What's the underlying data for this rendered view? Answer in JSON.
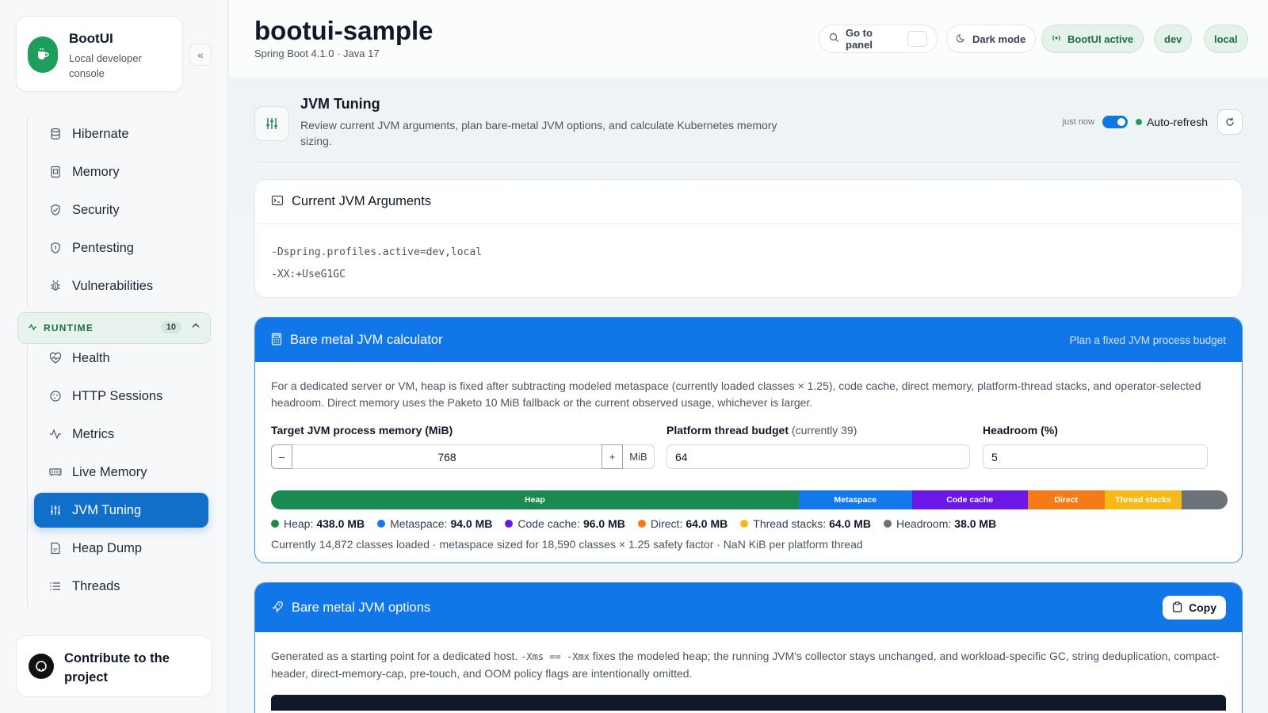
{
  "brand": {
    "title": "BootUI",
    "subtitle": "Local developer console",
    "collapse_icon": "«"
  },
  "sidebar": {
    "items_top": [
      {
        "label": "Hibernate",
        "icon": "database-icon"
      },
      {
        "label": "Memory",
        "icon": "memory-icon"
      },
      {
        "label": "Security",
        "icon": "shield-icon"
      },
      {
        "label": "Pentesting",
        "icon": "shield-alert-icon"
      },
      {
        "label": "Vulnerabilities",
        "icon": "bug-icon"
      }
    ],
    "runtime": {
      "label": "RUNTIME",
      "count": "10"
    },
    "items_runtime": [
      {
        "label": "Health",
        "icon": "heart-pulse-icon"
      },
      {
        "label": "HTTP Sessions",
        "icon": "cookie-icon"
      },
      {
        "label": "Metrics",
        "icon": "activity-icon"
      },
      {
        "label": "Live Memory",
        "icon": "memory-stick-icon"
      },
      {
        "label": "JVM Tuning",
        "icon": "sliders-icon",
        "active": true
      },
      {
        "label": "Heap Dump",
        "icon": "file-icon"
      },
      {
        "label": "Threads",
        "icon": "list-icon"
      }
    ],
    "contribute": "Contribute to the project"
  },
  "header": {
    "title": "bootui-sample",
    "subtitle": "Spring Boot 4.1.0 · Java 17",
    "goto_panel": "Go to panel",
    "dark_mode": "Dark mode",
    "bootui_active": "BootUI active",
    "profiles": [
      "dev",
      "local"
    ]
  },
  "section": {
    "title": "JVM Tuning",
    "description": "Review current JVM arguments, plan bare-metal JVM options, and calculate Kubernetes memory sizing.",
    "just_now": "just now",
    "auto_refresh": "Auto-refresh"
  },
  "current_args": {
    "title": "Current JVM Arguments",
    "lines": [
      "-Dspring.profiles.active=dev,local",
      "-XX:+UseG1GC"
    ]
  },
  "calculator": {
    "title": "Bare metal JVM calculator",
    "hint": "Plan a fixed JVM process budget",
    "description": "For a dedicated server or VM, heap is fixed after subtracting modeled metaspace (currently loaded classes × 1.25), code cache, direct memory, platform-thread stacks, and operator-selected headroom. Direct memory uses the Paketo 10 MiB fallback or the current observed usage, whichever is larger.",
    "target_label": "Target JVM process memory (MiB)",
    "target_value": "768",
    "unit": "MiB",
    "minus": "–",
    "plus": "+",
    "thread_label": "Platform thread budget",
    "thread_note": "(currently 39)",
    "thread_value": "64",
    "headroom_label": "Headroom (%)",
    "headroom_value": "5",
    "segments": [
      {
        "name": "Heap",
        "mb": 438.0,
        "value": "438.0 MB",
        "color": "#1a8a50",
        "show_label": true
      },
      {
        "name": "Metaspace",
        "mb": 94.0,
        "value": "94.0 MB",
        "color": "#1378ec",
        "show_label": true
      },
      {
        "name": "Code cache",
        "mb": 96.0,
        "value": "96.0 MB",
        "color": "#6b17e6",
        "show_label": true
      },
      {
        "name": "Direct",
        "mb": 64.0,
        "value": "64.0 MB",
        "color": "#f47b16",
        "show_label": true
      },
      {
        "name": "Thread stacks",
        "mb": 64.0,
        "value": "64.0 MB",
        "color": "#f6b918",
        "show_label": true
      },
      {
        "name": "Headroom",
        "mb": 38.0,
        "value": "38.0 MB",
        "color": "#6b7278",
        "show_label": false
      }
    ],
    "footnote": "Currently 14,872 classes loaded · metaspace sized for 18,590 classes × 1.25 safety factor · NaN KiB per platform thread"
  },
  "options": {
    "title": "Bare metal JVM options",
    "copy": "Copy",
    "desc_before": "Generated as a starting point for a dedicated host. ",
    "desc_code": "-Xms == -Xmx",
    "desc_after": " fixes the modeled heap; the running JVM's collector stays unchanged, and workload-specific GC, string deduplication, compact-header, direct-memory-cap, pre-touch, and OOM policy flags are intentionally omitted."
  }
}
